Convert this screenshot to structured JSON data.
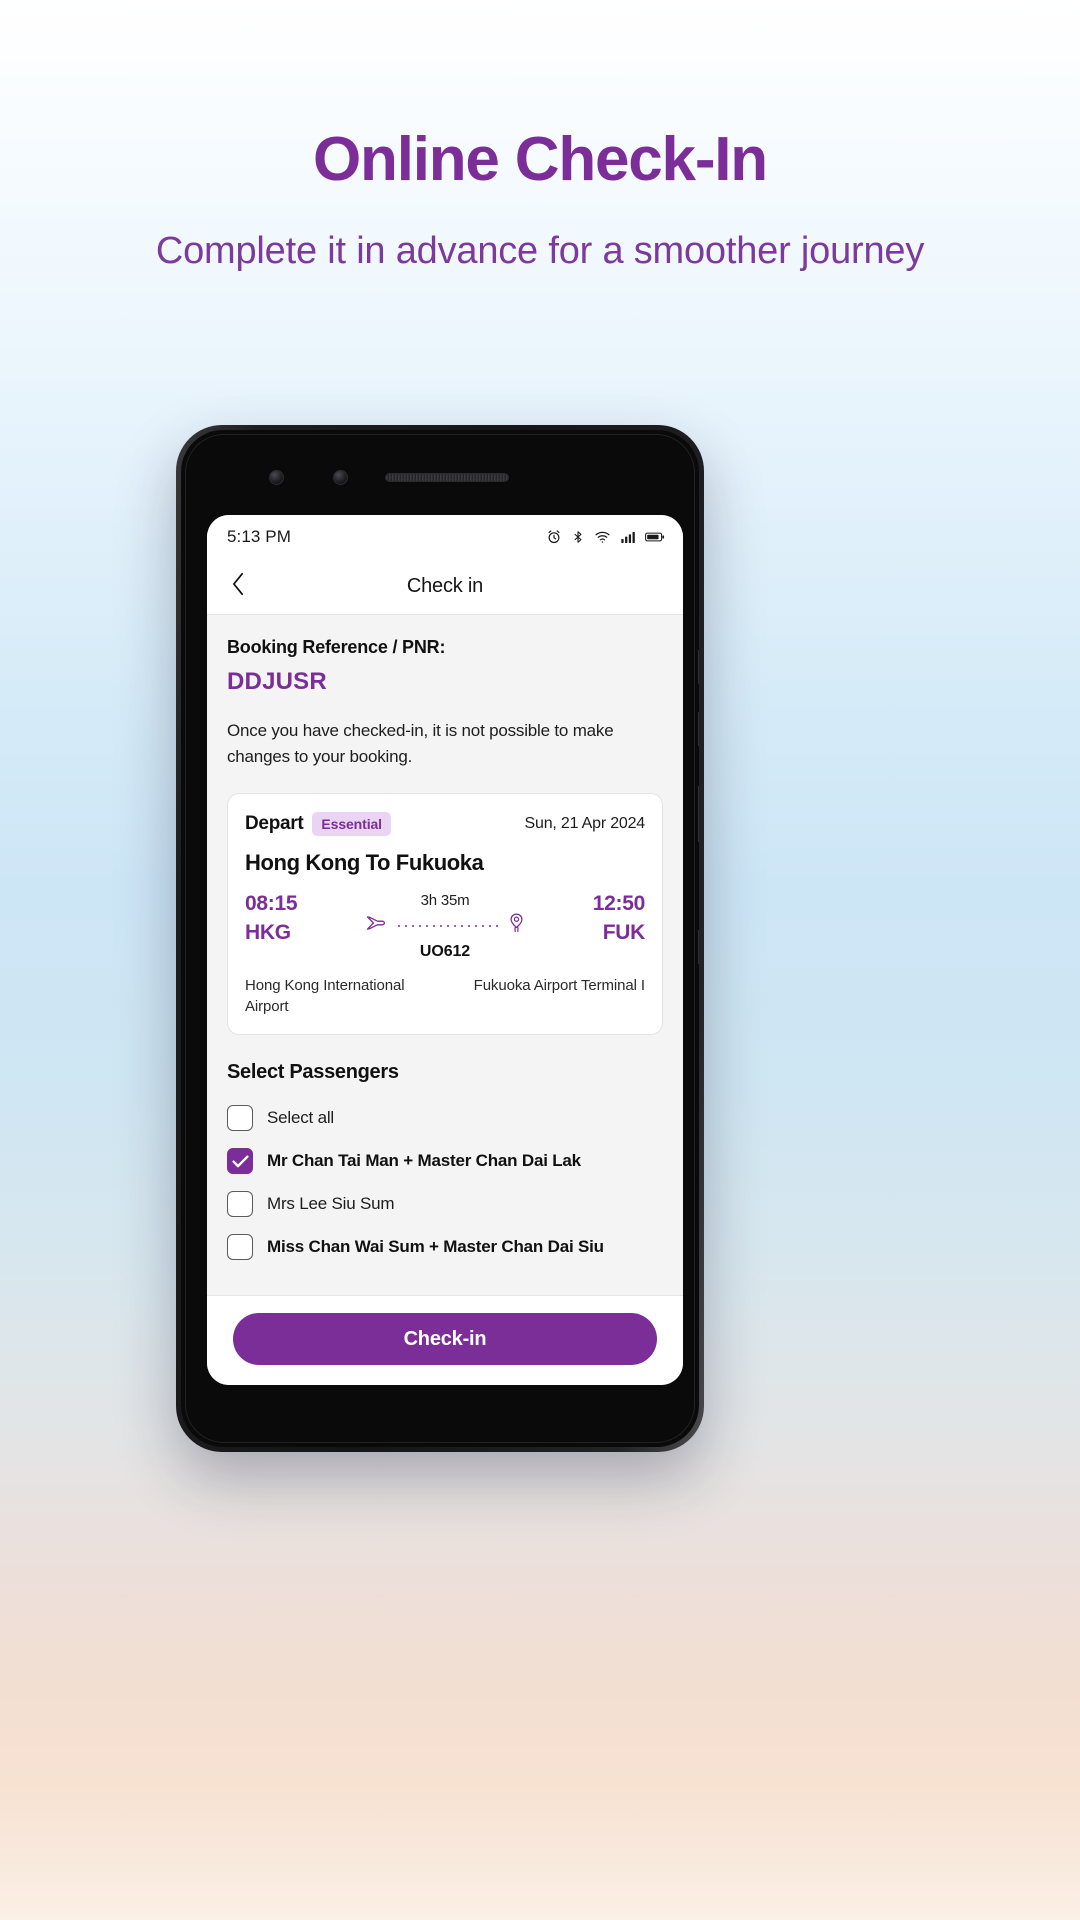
{
  "promo": {
    "title": "Online Check-In",
    "subtitle": "Complete it in advance for a smoother journey",
    "title_color": "#7b2d98",
    "subtitle_color": "#7b3a9c"
  },
  "phone": {
    "status_bar": {
      "time": "5:13 PM",
      "icons": [
        "alarm-icon",
        "bluetooth-icon",
        "wifi-icon",
        "cellular-signal-icon",
        "battery-icon"
      ]
    },
    "app_bar": {
      "back_icon": "chevron-left-icon",
      "title": "Check in"
    },
    "booking": {
      "pnr_label": "Booking Reference / PNR:",
      "pnr_value": "DDJUSR",
      "pnr_color": "#7b2d98",
      "notice": "Once you have checked-in, it is not possible to make changes to your booking."
    },
    "flight_card": {
      "direction": "Depart",
      "fare_badge": "Essential",
      "date": "Sun, 21 Apr 2024",
      "route": "Hong Kong To Fukuoka",
      "depart_time": "08:15",
      "depart_code": "HKG",
      "depart_airport": "Hong Kong International Airport",
      "duration": "3h 35m",
      "flight_number": "UO612",
      "arrive_time": "12:50",
      "arrive_code": "FUK",
      "arrive_airport": "Fukuoka Airport Terminal I",
      "plane_icon": "airplane-icon",
      "destination_icon": "map-pin-icon",
      "accent_color": "#7b2d98",
      "badge_bg": "#ead4f3"
    },
    "passengers": {
      "section_title": "Select Passengers",
      "items": [
        {
          "label": "Select all",
          "checked": false,
          "bold": false
        },
        {
          "label": "Mr Chan Tai Man + Master Chan Dai Lak",
          "checked": true,
          "bold": true
        },
        {
          "label": "Mrs Lee Siu Sum",
          "checked": false,
          "bold": false
        },
        {
          "label": "Miss Chan Wai Sum + Master Chan Dai Siu",
          "checked": false,
          "bold": true
        }
      ]
    },
    "footer": {
      "cta_label": "Check-in",
      "cta_color": "#7b2d98"
    }
  }
}
